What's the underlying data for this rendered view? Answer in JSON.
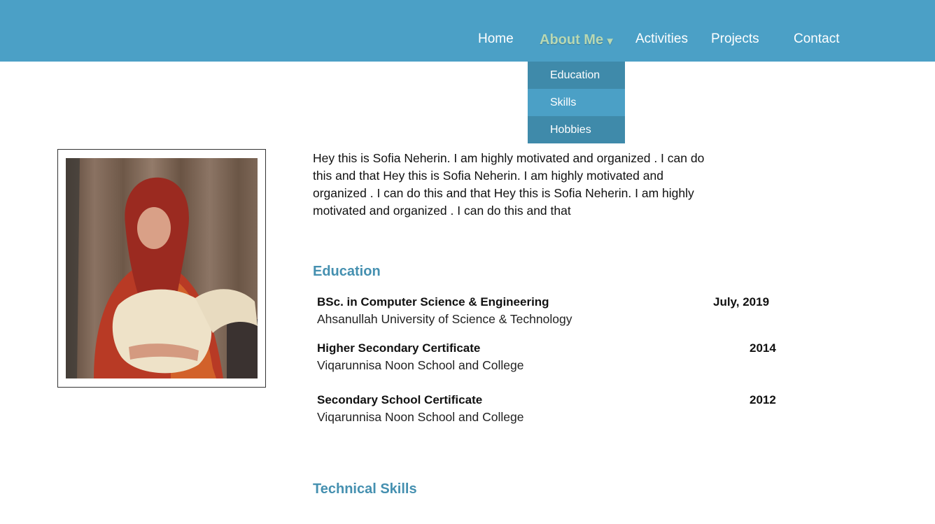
{
  "nav": {
    "items": [
      {
        "label": "Home"
      },
      {
        "label": "About Me"
      },
      {
        "label": "Activities"
      },
      {
        "label": "Projects"
      },
      {
        "label": "Contact"
      }
    ],
    "active": "About Me",
    "about_caret": "▼"
  },
  "dropdown": {
    "items": [
      {
        "label": "Education"
      },
      {
        "label": "Skills"
      },
      {
        "label": "Hobbies"
      }
    ]
  },
  "bio": {
    "text": "Hey this is Sofia Neherin. I  am highly motivated and organized . I can do this and that Hey this is Sofia Neherin. I  am highly motivated and organized . I can do this and that Hey this is Sofia Neherin. I  am highly motivated and organized . I can do this and that"
  },
  "education": {
    "title": "Education",
    "entries": [
      {
        "degree": "BSc. in Computer Science & Engineering",
        "school": "Ahsanullah University of Science & Technology",
        "year": "July, 2019"
      },
      {
        "degree": "Higher Secondary Certificate",
        "school": "Viqarunnisa Noon School and College",
        "year": "2014"
      },
      {
        "degree": "Secondary School Certificate",
        "school": "Viqarunnisa Noon School and College",
        "year": "2012"
      }
    ]
  },
  "technical_skills": {
    "title": "Technical Skills"
  },
  "colors": {
    "navbar": "#4ba0c6",
    "dropdown_dark": "#3f8aaa",
    "active_nav": "#b8d8b3",
    "section_title": "#4590b0"
  }
}
